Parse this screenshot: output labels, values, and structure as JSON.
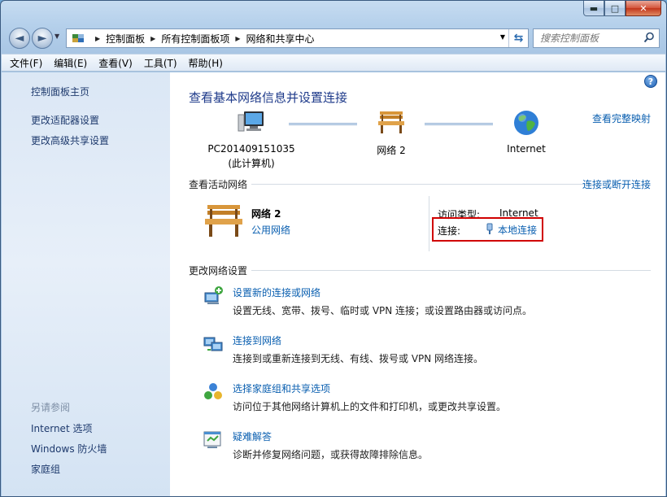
{
  "window": {
    "controls": {
      "minimize": "▬",
      "maximize": "□",
      "close": "✕"
    }
  },
  "nav": {
    "back_glyph": "◄",
    "forward_glyph": "►",
    "breadcrumbs": [
      "控制面板",
      "所有控制面板项",
      "网络和共享中心"
    ],
    "search_placeholder": "搜索控制面板"
  },
  "menu": [
    "文件(F)",
    "编辑(E)",
    "查看(V)",
    "工具(T)",
    "帮助(H)"
  ],
  "sidebar": {
    "links": [
      "控制面板主页",
      "更改适配器设置",
      "更改高级共享设置"
    ],
    "see_also_heading": "另请参阅",
    "see_also": [
      "Internet 选项",
      "Windows 防火墙",
      "家庭组"
    ]
  },
  "main": {
    "title": "查看基本网络信息并设置连接",
    "full_map_link": "查看完整映射",
    "map_nodes": [
      {
        "label": "PC201409151035",
        "sublabel": "(此计算机)",
        "icon": "computer-icon"
      },
      {
        "label": "网络  2",
        "sublabel": "",
        "icon": "bench-icon"
      },
      {
        "label": "Internet",
        "sublabel": "",
        "icon": "globe-icon"
      }
    ],
    "active_networks_heading": "查看活动网络",
    "connect_disconnect_link": "连接或断开连接",
    "active_network": {
      "name": "网络  2",
      "type": "公用网络",
      "access_type_label": "访问类型:",
      "access_type_value": "Internet",
      "connection_label": "连接:",
      "connection_value": "本地连接"
    },
    "change_settings_heading": "更改网络设置",
    "tasks": [
      {
        "title": "设置新的连接或网络",
        "desc": "设置无线、宽带、拨号、临时或 VPN 连接；或设置路由器或访问点。",
        "icon": "new-connection-icon"
      },
      {
        "title": "连接到网络",
        "desc": "连接到或重新连接到无线、有线、拨号或 VPN 网络连接。",
        "icon": "connect-network-icon"
      },
      {
        "title": "选择家庭组和共享选项",
        "desc": "访问位于其他网络计算机上的文件和打印机，或更改共享设置。",
        "icon": "homegroup-icon"
      },
      {
        "title": "疑难解答",
        "desc": "诊断并修复网络问题，或获得故障排除信息。",
        "icon": "troubleshoot-icon"
      }
    ]
  },
  "colors": {
    "link": "#0a5fb0",
    "title": "#1e3a8a",
    "highlight": "#d00000",
    "sidebar_link": "#1e3a6d"
  }
}
